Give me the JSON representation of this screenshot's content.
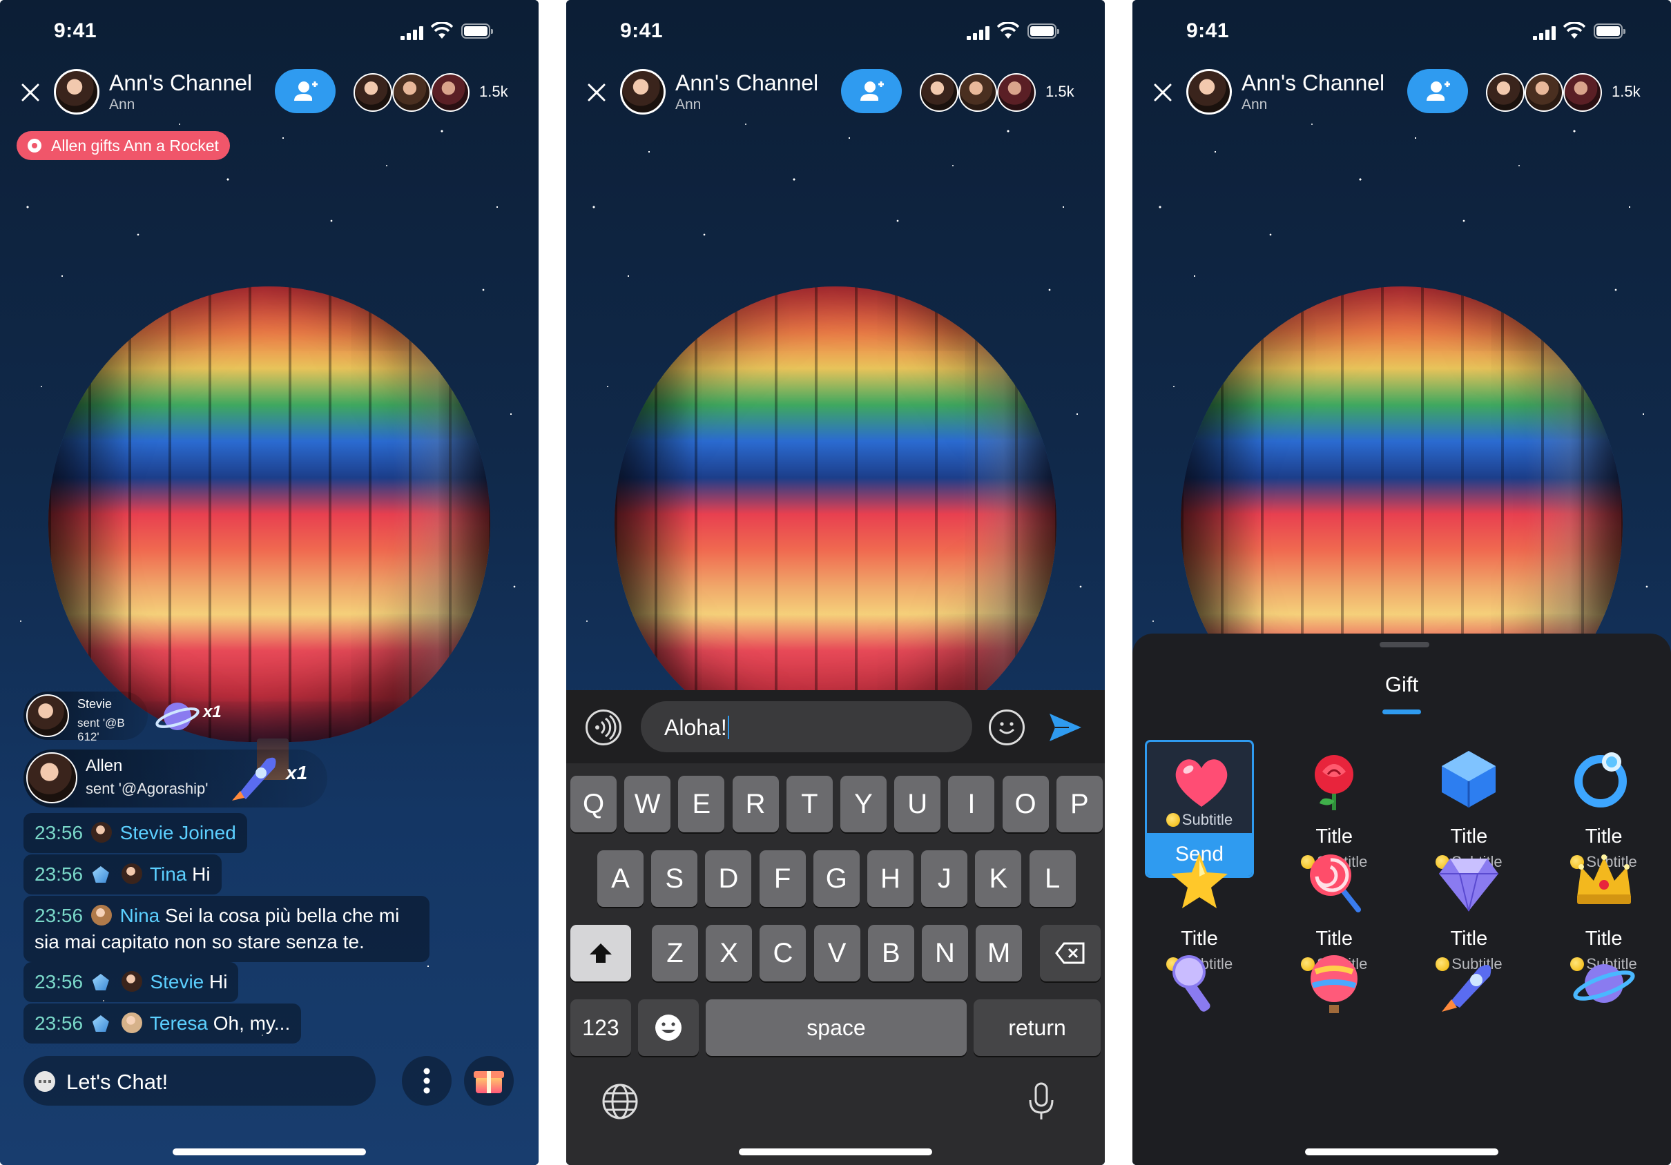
{
  "status": {
    "time": "9:41"
  },
  "header": {
    "title": "Ann's Channel",
    "host": "Ann",
    "viewer_count": "1.5k"
  },
  "screen1": {
    "gift_banner": "Allen gifts Ann a Rocket",
    "gift_messages": [
      {
        "name": "Stevie",
        "desc": "sent '@B 612'",
        "count": "x1"
      },
      {
        "name": "Allen",
        "desc": "sent '@Agoraship'",
        "count": "x1"
      }
    ],
    "messages": [
      {
        "time": "23:56",
        "name": "Stevie",
        "text": "Joined"
      },
      {
        "time": "23:56",
        "name": "Tina",
        "text": "Hi"
      },
      {
        "time": "23:56",
        "name": "Nina",
        "text": "Sei la cosa più bella che mi sia mai capitato non so stare senza te."
      },
      {
        "time": "23:56",
        "name": "Stevie",
        "text": "Hi"
      },
      {
        "time": "23:56",
        "name": "Teresa",
        "text": "Oh, my..."
      }
    ],
    "chat_placeholder": "Let's Chat!"
  },
  "screen2": {
    "input_value": "Aloha!",
    "keyboard": {
      "row1": [
        "Q",
        "W",
        "E",
        "R",
        "T",
        "Y",
        "U",
        "I",
        "O",
        "P"
      ],
      "row2": [
        "A",
        "S",
        "D",
        "F",
        "G",
        "H",
        "J",
        "K",
        "L"
      ],
      "row3": [
        "Z",
        "X",
        "C",
        "V",
        "B",
        "N",
        "M"
      ],
      "numbers_key": "123",
      "space_key": "space",
      "return_key": "return"
    }
  },
  "screen3": {
    "panel_title": "Gift",
    "send_label": "Send",
    "gifts": [
      {
        "icon": "heart-icon",
        "title": "",
        "subtitle": "Subtitle",
        "selected": true
      },
      {
        "icon": "rose-icon",
        "title": "Title",
        "subtitle": "Subtitle"
      },
      {
        "icon": "crystal-cube-icon",
        "title": "Title",
        "subtitle": "Subtitle"
      },
      {
        "icon": "ring-icon",
        "title": "Title",
        "subtitle": "Subtitle"
      },
      {
        "icon": "star-icon",
        "title": "Title",
        "subtitle": "Subtitle"
      },
      {
        "icon": "lollipop-icon",
        "title": "Title",
        "subtitle": "Subtitle"
      },
      {
        "icon": "diamond-icon",
        "title": "Title",
        "subtitle": "Subtitle"
      },
      {
        "icon": "crown-icon",
        "title": "Title",
        "subtitle": "Subtitle"
      },
      {
        "icon": "microphone-icon",
        "title": "",
        "subtitle": ""
      },
      {
        "icon": "balloon-icon",
        "title": "",
        "subtitle": ""
      },
      {
        "icon": "rocket-icon",
        "title": "",
        "subtitle": ""
      },
      {
        "icon": "planet-icon",
        "title": "",
        "subtitle": ""
      }
    ]
  },
  "colors": {
    "accent": "#2f9bf0",
    "banner": "#f0566a",
    "timestamp": "#7ad8c9",
    "username": "#5cd0ff"
  }
}
